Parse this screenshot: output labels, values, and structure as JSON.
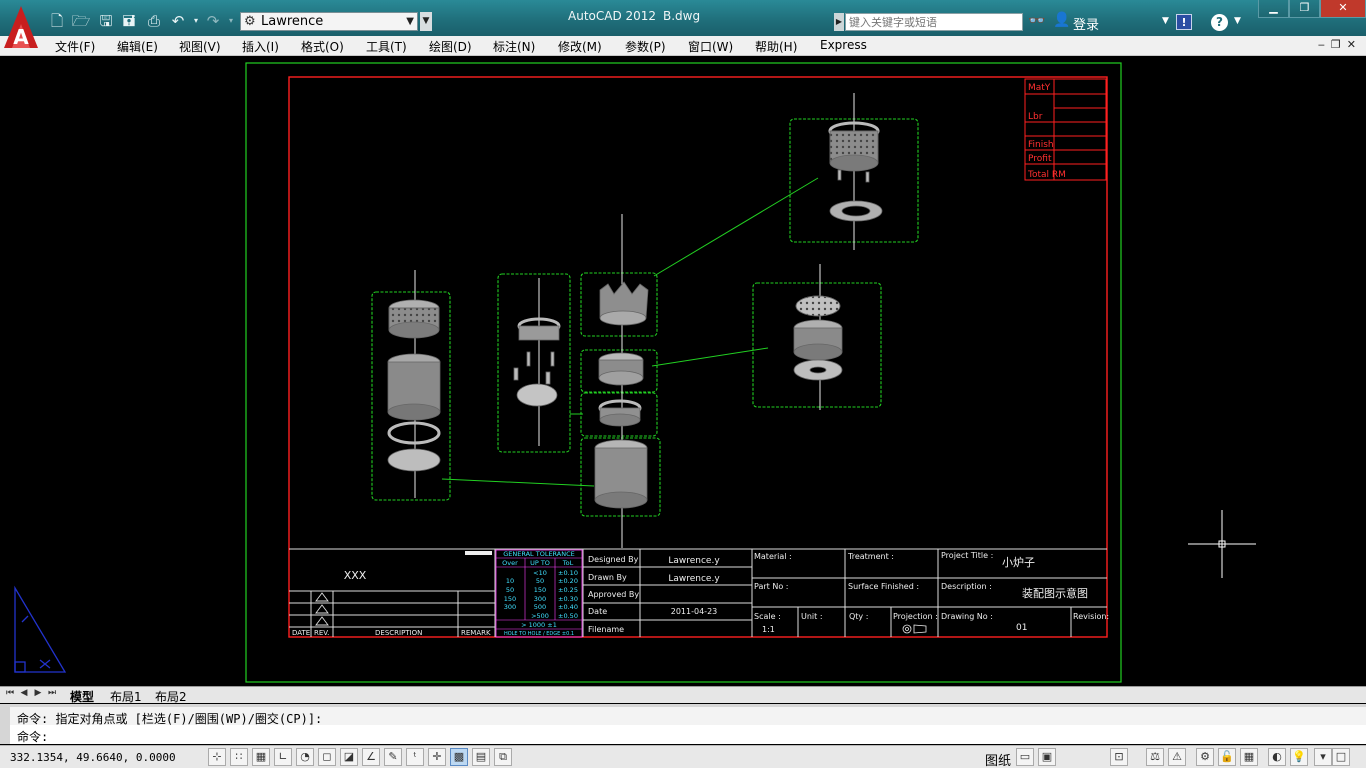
{
  "titlebar": {
    "app_title": "AutoCAD 2012",
    "doc_title": "B.dwg",
    "workspace": "Lawrence",
    "search_placeholder": "键入关键字或短语",
    "login_label": "登录",
    "help_glyph": "?",
    "exchange_glyph": "!",
    "logo_letter": "A"
  },
  "menubar": {
    "items": [
      "文件(F)",
      "编辑(E)",
      "视图(V)",
      "插入(I)",
      "格式(O)",
      "工具(T)",
      "绘图(D)",
      "标注(N)",
      "修改(M)",
      "参数(P)",
      "窗口(W)",
      "帮助(H)",
      "Express"
    ]
  },
  "drawing": {
    "cost_table_labels": [
      "MatY",
      "Lbr",
      "Finish",
      "Profit",
      "Total RM"
    ],
    "title_block": {
      "project_mark": "XXX",
      "tolerance_title": "GENERAL TOLERANCE",
      "tolerance_headers": [
        "Over",
        "UP TO",
        "ToL"
      ],
      "tolerance_rows": [
        [
          "",
          "<10",
          "±0.10"
        ],
        [
          "10",
          "50",
          "±0.20"
        ],
        [
          "50",
          "150",
          "±0.25"
        ],
        [
          "150",
          "300",
          "±0.30"
        ],
        [
          "300",
          "500",
          "±0.40"
        ],
        [
          "",
          ">500",
          "±0.50"
        ]
      ],
      "tolerance_extra": "> 1000 ±1",
      "tolerance_footer": "HOLE TO HOLE / EDGE ±0.1",
      "revision_headers": [
        "DATE",
        "REV.",
        "DESCRIPTION",
        "REMARK"
      ],
      "designed_by_label": "Designed By",
      "designed_by": "Lawrence.y",
      "drawn_by_label": "Drawn By",
      "drawn_by": "Lawrence.y",
      "approved_by_label": "Approved By",
      "date_label": "Date",
      "date": "2011-04-23",
      "filename_label": "Filename",
      "material_label": "Material :",
      "treatment_label": "Treatment :",
      "project_title_label": "Project Title :",
      "project_title": "小炉子",
      "part_no_label": "Part No :",
      "surface_label": "Surface Finished :",
      "description_label": "Description :",
      "description": "装配图示意图",
      "scale_label": "Scale :",
      "scale": "1:1",
      "unit_label": "Unit :",
      "qty_label": "Qty :",
      "projection_label": "Projection :",
      "drawing_no_label": "Drawing No :",
      "drawing_no": "01",
      "revision_label": "Revision:"
    }
  },
  "tabs": {
    "model": "模型",
    "layout1": "布局1",
    "layout2": "布局2"
  },
  "command": {
    "line1": "命令: 指定对角点或 [栏选(F)/圈围(WP)/圈交(CP)]:",
    "line2": "命令:"
  },
  "statusbar": {
    "coords": "332.1354, 49.6640, 0.0000",
    "paper_label": "图纸"
  },
  "colors": {
    "title_bg": "#1f6d79",
    "frame_red": "#ff2020",
    "viewport_green": "#22d022",
    "tolerance_magenta": "#ff40ff",
    "tolerance_cyan": "#40e0ff"
  }
}
